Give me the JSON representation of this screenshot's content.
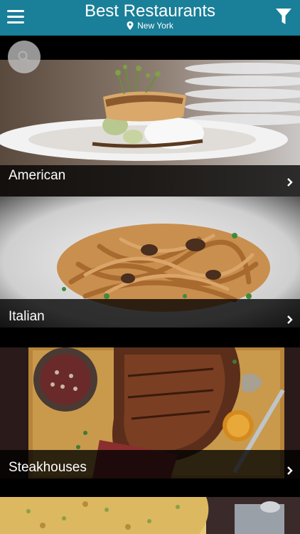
{
  "header": {
    "title": "Best Restaurants",
    "location": "New York"
  },
  "categories": [
    {
      "label": "American"
    },
    {
      "label": "Italian"
    },
    {
      "label": "Steakhouses"
    },
    {
      "label": ""
    }
  ],
  "colors": {
    "header_bg": "#1a7f98",
    "label_bar": "rgba(0,0,0,0.78)"
  },
  "icons": [
    "menu-icon",
    "map-pin-icon",
    "filter-icon",
    "search-icon",
    "chevron-right-icon"
  ]
}
